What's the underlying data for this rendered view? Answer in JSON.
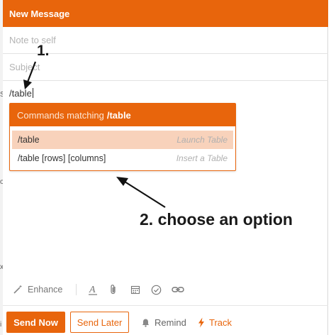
{
  "compose": {
    "title": "New Message",
    "to_placeholder": "Note to self",
    "subject_placeholder": "Subject",
    "body_text": "/table"
  },
  "command_menu": {
    "header_prefix": "Commands matching",
    "query": "/table",
    "items": [
      {
        "command": "/table",
        "hint": "Launch Table",
        "selected": true
      },
      {
        "command": "/table [rows] [columns]",
        "hint": "Insert a Table",
        "selected": false
      }
    ]
  },
  "annotations": {
    "step1": "1.",
    "step2": "2. choose an option"
  },
  "toolbar": {
    "enhance_label": "Enhance",
    "icons": [
      "format-text-icon",
      "attachment-icon",
      "calendar-icon",
      "check-circle-icon",
      "link-icon"
    ]
  },
  "footer": {
    "send_now": "Send Now",
    "send_later": "Send Later",
    "remind": "Remind",
    "track": "Track"
  },
  "colors": {
    "accent": "#e8650c",
    "selected_row": "#f8d2bb"
  }
}
